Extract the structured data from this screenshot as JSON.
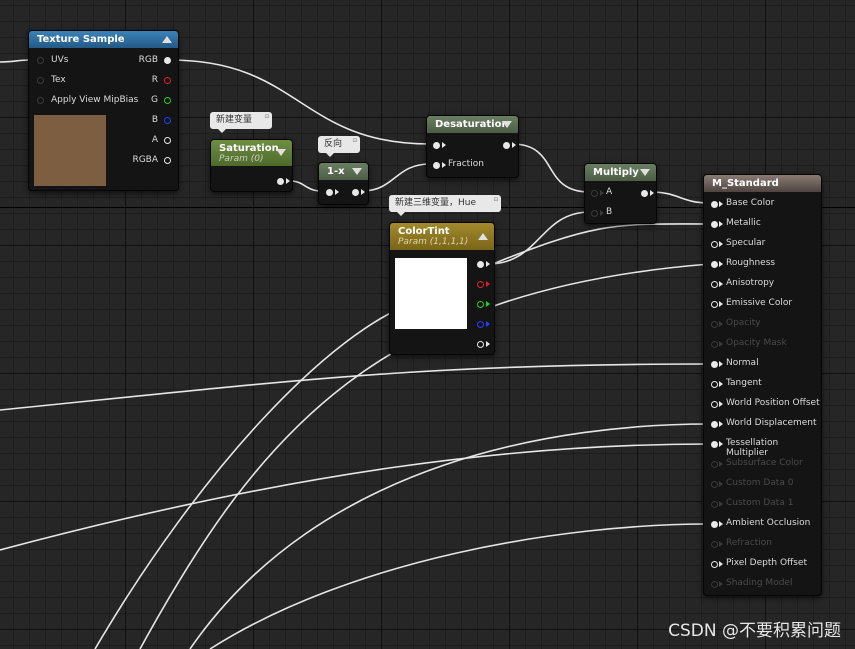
{
  "colors": {
    "texture_header": "#2b6a9a",
    "param_header": "#5e7a3a",
    "math_header": "#5c6e55",
    "vector_header": "#8a7424",
    "result_header": "#6a5c54",
    "texture_preview": "#7e5e40",
    "color_preview": "#ffffff"
  },
  "texture_sample": {
    "title": "Texture Sample",
    "inputs": [
      "UVs",
      "Tex",
      "Apply View MipBias"
    ],
    "outputs": [
      "RGB",
      "R",
      "G",
      "B",
      "A",
      "RGBA"
    ]
  },
  "saturation": {
    "comment": "新建变量",
    "title": "Saturation",
    "subtitle": "Param (0)"
  },
  "one_minus": {
    "comment": "反向",
    "title": "1-x"
  },
  "desaturation": {
    "title": "Desaturation",
    "inputs": [
      "",
      "Fraction"
    ]
  },
  "multiply": {
    "title": "Multiply",
    "inputs": [
      "A",
      "B"
    ]
  },
  "color_tint": {
    "comment": "新建三维变量，Hue",
    "title": "ColorTint",
    "subtitle": "Param (1,1,1,1)"
  },
  "m_standard": {
    "title": "M_Standard",
    "inputs": [
      {
        "label": "Base Color",
        "enabled": true
      },
      {
        "label": "Metallic",
        "enabled": true
      },
      {
        "label": "Specular",
        "enabled": true
      },
      {
        "label": "Roughness",
        "enabled": true
      },
      {
        "label": "Anisotropy",
        "enabled": true
      },
      {
        "label": "Emissive Color",
        "enabled": true
      },
      {
        "label": "Opacity",
        "enabled": false
      },
      {
        "label": "Opacity Mask",
        "enabled": false
      },
      {
        "label": "Normal",
        "enabled": true
      },
      {
        "label": "Tangent",
        "enabled": true
      },
      {
        "label": "World Position Offset",
        "enabled": true
      },
      {
        "label": "World Displacement",
        "enabled": true
      },
      {
        "label": "Tessellation Multiplier",
        "enabled": true
      },
      {
        "label": "Subsurface Color",
        "enabled": false
      },
      {
        "label": "Custom Data 0",
        "enabled": false
      },
      {
        "label": "Custom Data 1",
        "enabled": false
      },
      {
        "label": "Ambient Occlusion",
        "enabled": true
      },
      {
        "label": "Refraction",
        "enabled": false
      },
      {
        "label": "Pixel Depth Offset",
        "enabled": true
      },
      {
        "label": "Shading Model",
        "enabled": false
      }
    ]
  },
  "watermark": "CSDN @不要积累问题"
}
